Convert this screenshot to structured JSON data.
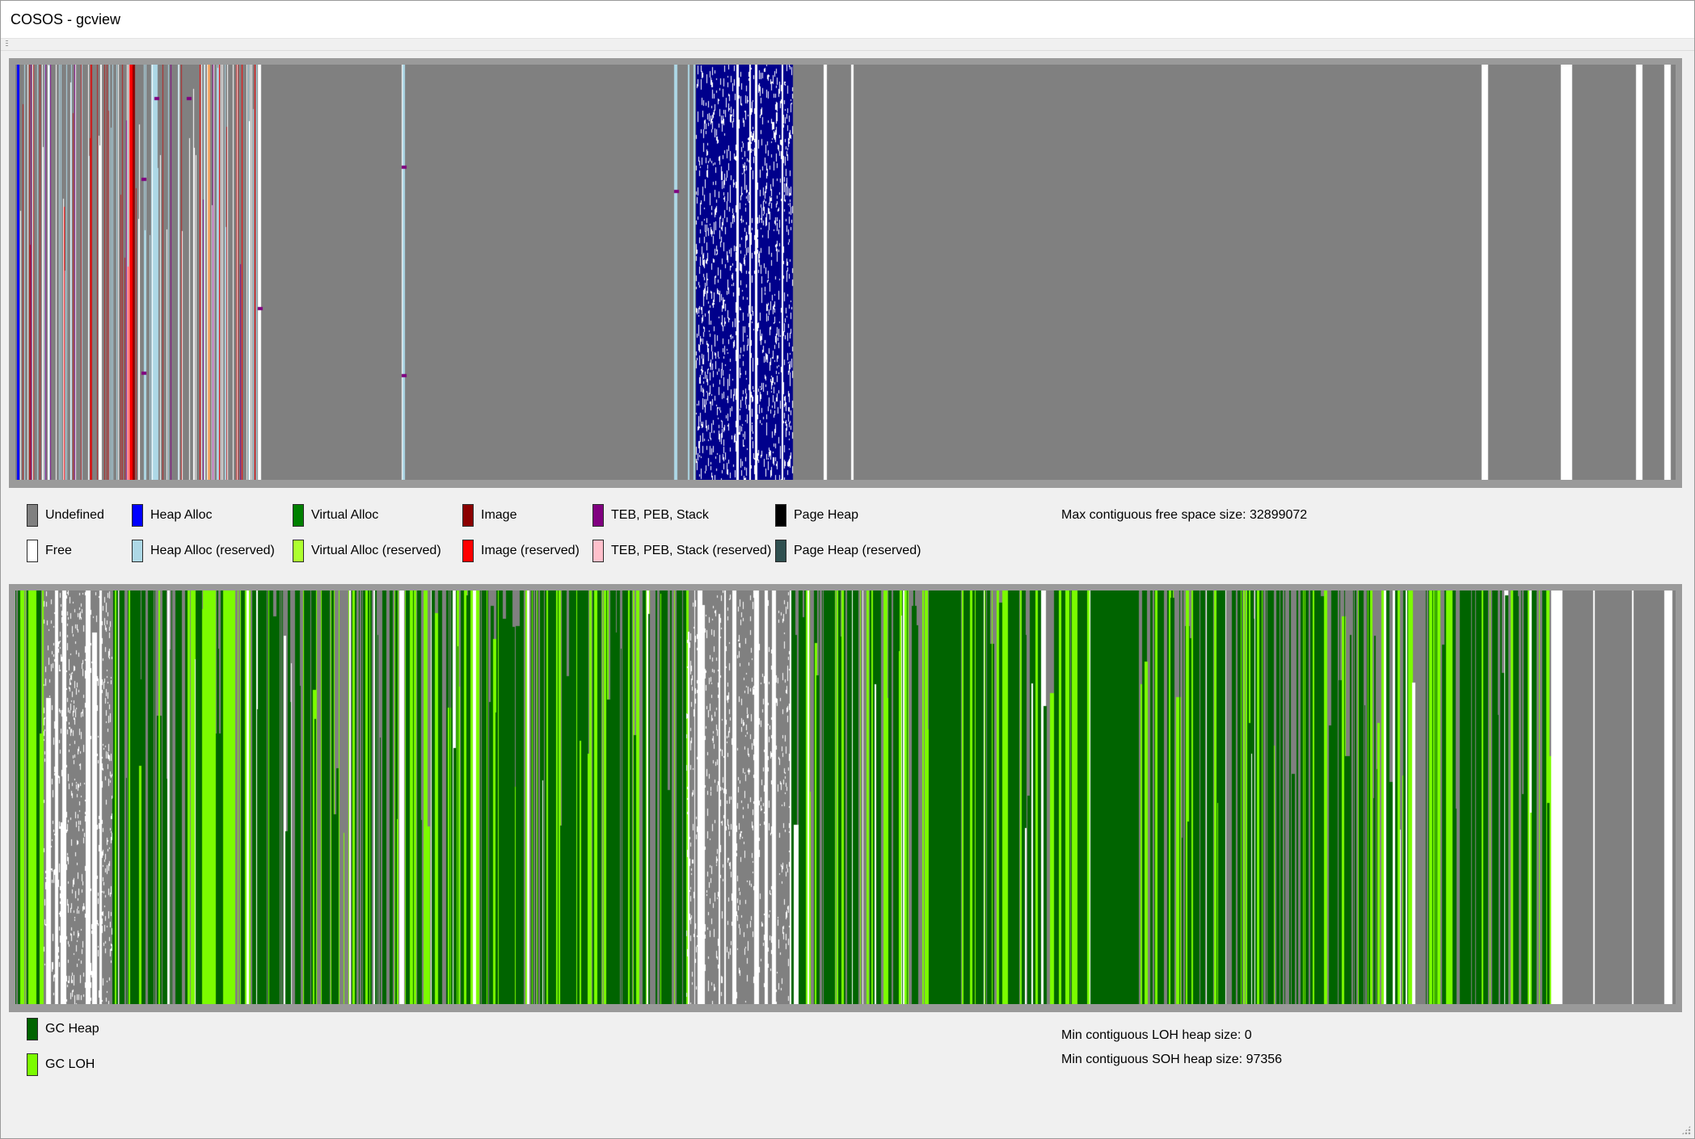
{
  "window": {
    "title": "COSOS - gcview"
  },
  "colors": {
    "undefined": "#808080",
    "free": "#ffffff",
    "heap_alloc": "#0000ff",
    "heap_alloc_dark": "#00008b",
    "heap_alloc_reserved": "#add8e6",
    "virtual_alloc": "#008000",
    "virtual_alloc_dark": "#006400",
    "virtual_alloc_reserved": "#adff2f",
    "image": "#8b0000",
    "image_reserved": "#ff0000",
    "teb_peb_stack": "#800080",
    "teb_peb_stack_reserved": "#ffc0cb",
    "page_heap": "#000000",
    "page_heap_reserved": "#2f4f4f",
    "gc_heap": "#006400",
    "gc_loh": "#7cfc00",
    "frame": "#9a9a9a"
  },
  "memory_legend": [
    {
      "label": "Undefined",
      "color": "#808080"
    },
    {
      "label": "Free",
      "color": "#ffffff"
    },
    {
      "label": "Heap Alloc",
      "color": "#0000ff"
    },
    {
      "label": "Heap Alloc (reserved)",
      "color": "#add8e6"
    },
    {
      "label": "Virtual Alloc",
      "color": "#008000"
    },
    {
      "label": "Virtual Alloc (reserved)",
      "color": "#adff2f"
    },
    {
      "label": "Image",
      "color": "#8b0000"
    },
    {
      "label": "Image (reserved)",
      "color": "#ff0000"
    },
    {
      "label": "TEB, PEB, Stack",
      "color": "#800080"
    },
    {
      "label": "TEB, PEB, Stack (reserved)",
      "color": "#ffc0cb"
    },
    {
      "label": "Page Heap",
      "color": "#000000"
    },
    {
      "label": "Page Heap (reserved)",
      "color": "#2f4f4f"
    }
  ],
  "gc_legend": [
    {
      "label": "GC Heap",
      "color": "#006400"
    },
    {
      "label": "GC LOH",
      "color": "#7cfc00"
    }
  ],
  "stats": {
    "max_free": "Max contiguous free space size: 32899072",
    "min_loh": "Min contiguous LOH heap size: 0",
    "min_soh": "Min contiguous SOH heap size: 97356"
  }
}
